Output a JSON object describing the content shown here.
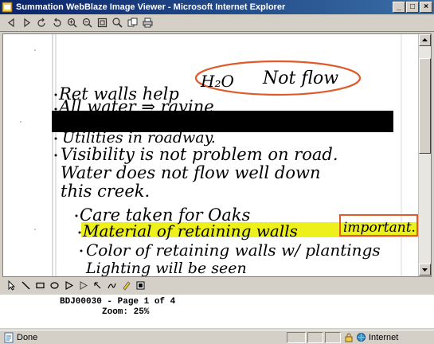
{
  "window": {
    "title": "Summation WebBlaze Image Viewer - Microsoft Internet Explorer",
    "minimize": "_",
    "maximize": "□",
    "close": "×"
  },
  "document": {
    "lines": [
      "Ret walls help",
      "H₂O",
      "Not flow",
      "All water ⇒ ravine",
      "Utilities in roadway.",
      "Visibility is not problem on road.",
      "Water does not flow well down",
      "this creek.",
      "Care taken for Oaks",
      "Material of retaining walls",
      "important.",
      "Color of retaining walls w/ plantings",
      "Lighting will be seen"
    ]
  },
  "doc_info": {
    "id_line": "BDJ00030 - Page 1 of 4",
    "zoom_line": "Zoom: 25%"
  },
  "status": {
    "text": "Done",
    "zone": "Internet"
  },
  "colors": {
    "highlight": "#eef01c",
    "ellipse": "#e05a2a",
    "box": "#e05a2a",
    "redaction": "#000000"
  }
}
